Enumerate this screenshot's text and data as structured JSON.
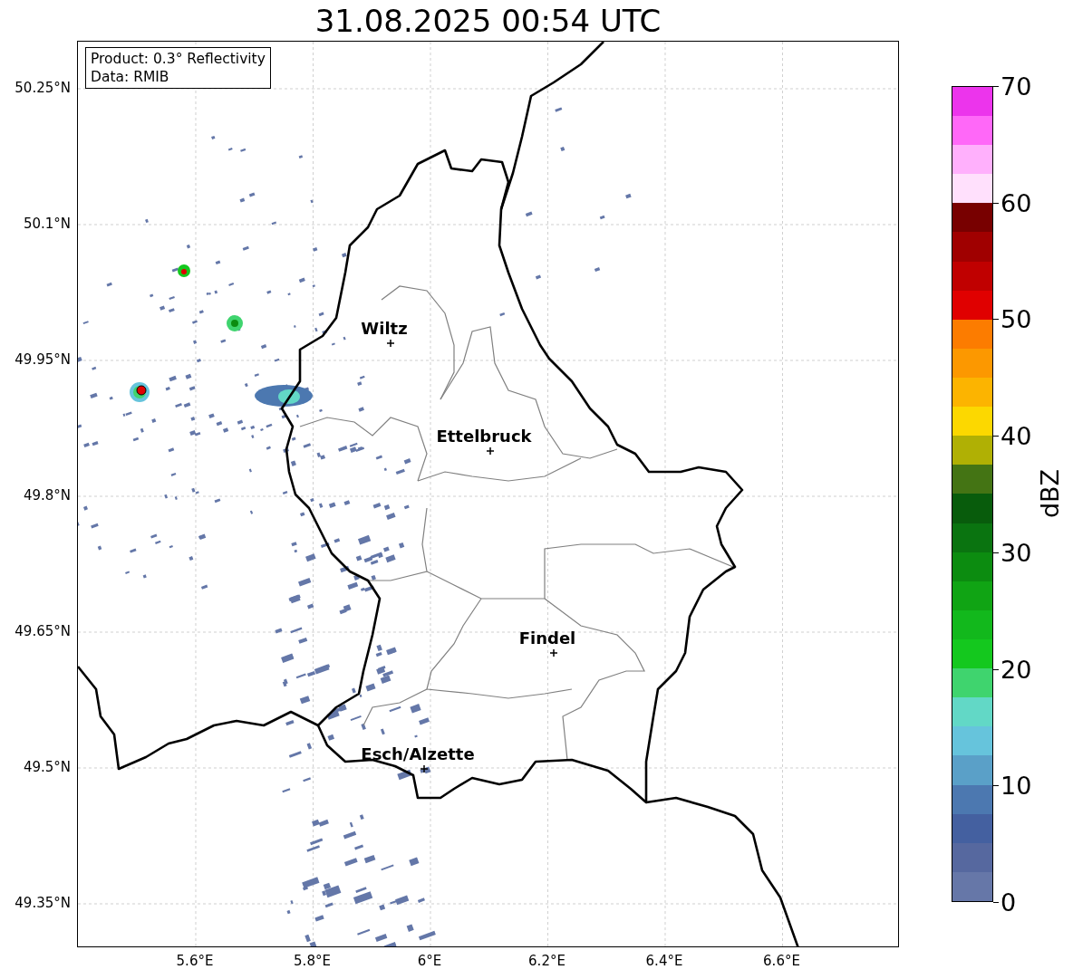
{
  "title": "31.08.2025 00:54 UTC",
  "info_box": [
    "Product: 0.3° Reflectivity",
    "Data: RMIB"
  ],
  "cities": [
    {
      "name": "Wiltz"
    },
    {
      "name": "Ettelbruck"
    },
    {
      "name": "Findel"
    },
    {
      "name": "Esch/Alzette"
    }
  ],
  "yticks": [
    "50.25°N",
    "50.1°N",
    "49.95°N",
    "49.8°N",
    "49.65°N",
    "49.5°N",
    "49.35°N"
  ],
  "xticks": [
    "5.6°E",
    "5.8°E",
    "6°E",
    "6.2°E",
    "6.4°E",
    "6.6°E"
  ],
  "colorbar": {
    "label": "dBZ",
    "ticks": [
      "70",
      "60",
      "50",
      "40",
      "30",
      "20",
      "10",
      "0"
    ],
    "bins": [
      {
        "color": "#6677a8"
      },
      {
        "color": "#56689f"
      },
      {
        "color": "#4460a0"
      },
      {
        "color": "#4c78b0"
      },
      {
        "color": "#5aa0c8"
      },
      {
        "color": "#66c4dc"
      },
      {
        "color": "#62d8c6"
      },
      {
        "color": "#3fd46e"
      },
      {
        "color": "#14c81e"
      },
      {
        "color": "#12b81c"
      },
      {
        "color": "#10a414"
      },
      {
        "color": "#0c8c10"
      },
      {
        "color": "#0a7410"
      },
      {
        "color": "#085c0c"
      },
      {
        "color": "#447414"
      },
      {
        "color": "#b0b004"
      },
      {
        "color": "#fcd800"
      },
      {
        "color": "#fcb400"
      },
      {
        "color": "#fc9800"
      },
      {
        "color": "#fc7c00"
      },
      {
        "color": "#e00000"
      },
      {
        "color": "#c00000"
      },
      {
        "color": "#a00000"
      },
      {
        "color": "#780000"
      },
      {
        "color": "#ffe0fc"
      },
      {
        "color": "#ffb0fc"
      },
      {
        "color": "#ff68f8"
      },
      {
        "color": "#ec34ec"
      }
    ]
  }
}
